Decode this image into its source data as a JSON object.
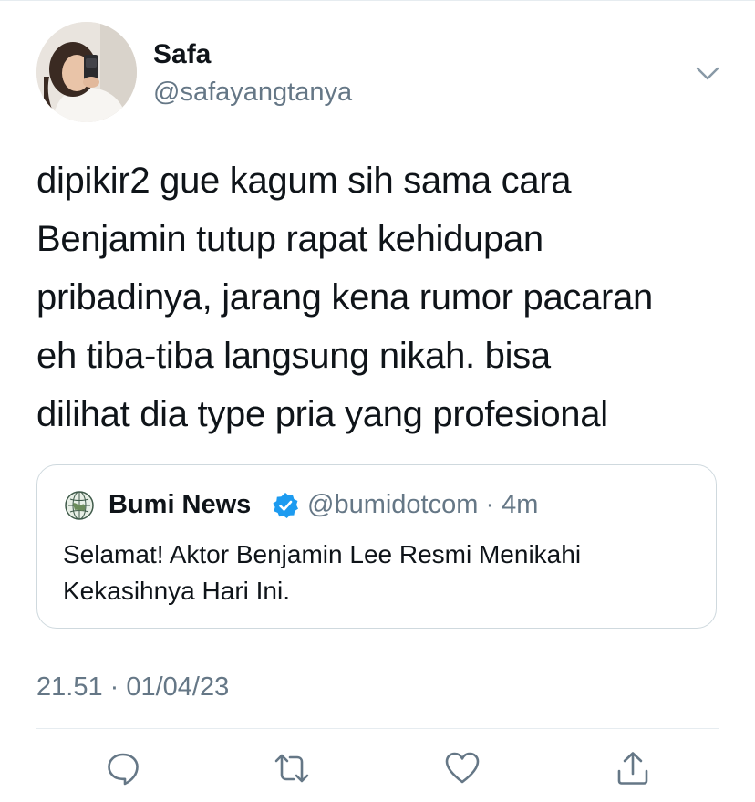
{
  "tweet": {
    "author": {
      "display_name": "Safa",
      "handle": "@safayangtanya",
      "avatar_icon": "profile-photo"
    },
    "text_lines": [
      "dipikir2 gue kagum sih sama cara",
      "Benjamin tutup rapat kehidupan",
      "pribadinya, jarang kena rumor pacaran",
      "eh tiba-tiba langsung nikah. bisa",
      "dilihat dia type pria yang profesional"
    ],
    "timestamp": "21.51 · 01/04/23"
  },
  "quote": {
    "name": "Bumi News",
    "verified": true,
    "handle_time": "@bumidotcom · 4m",
    "text_lines": [
      "Selamat! Aktor Benjamin Lee Resmi Menikahi",
      "Kekasihnya Hari Ini."
    ],
    "logo_icon": "globe-logo"
  },
  "actions": [
    {
      "name": "reply",
      "icon": "speech-bubble-icon"
    },
    {
      "name": "retweet",
      "icon": "retweet-arrows-icon"
    },
    {
      "name": "like",
      "icon": "heart-icon"
    },
    {
      "name": "share",
      "icon": "share-upload-icon"
    }
  ],
  "colors": {
    "text_primary": "#0f1419",
    "text_secondary": "#657786",
    "border": "#cfd9de",
    "divider": "#e6ecf0",
    "verified_blue": "#1d9bf0"
  }
}
